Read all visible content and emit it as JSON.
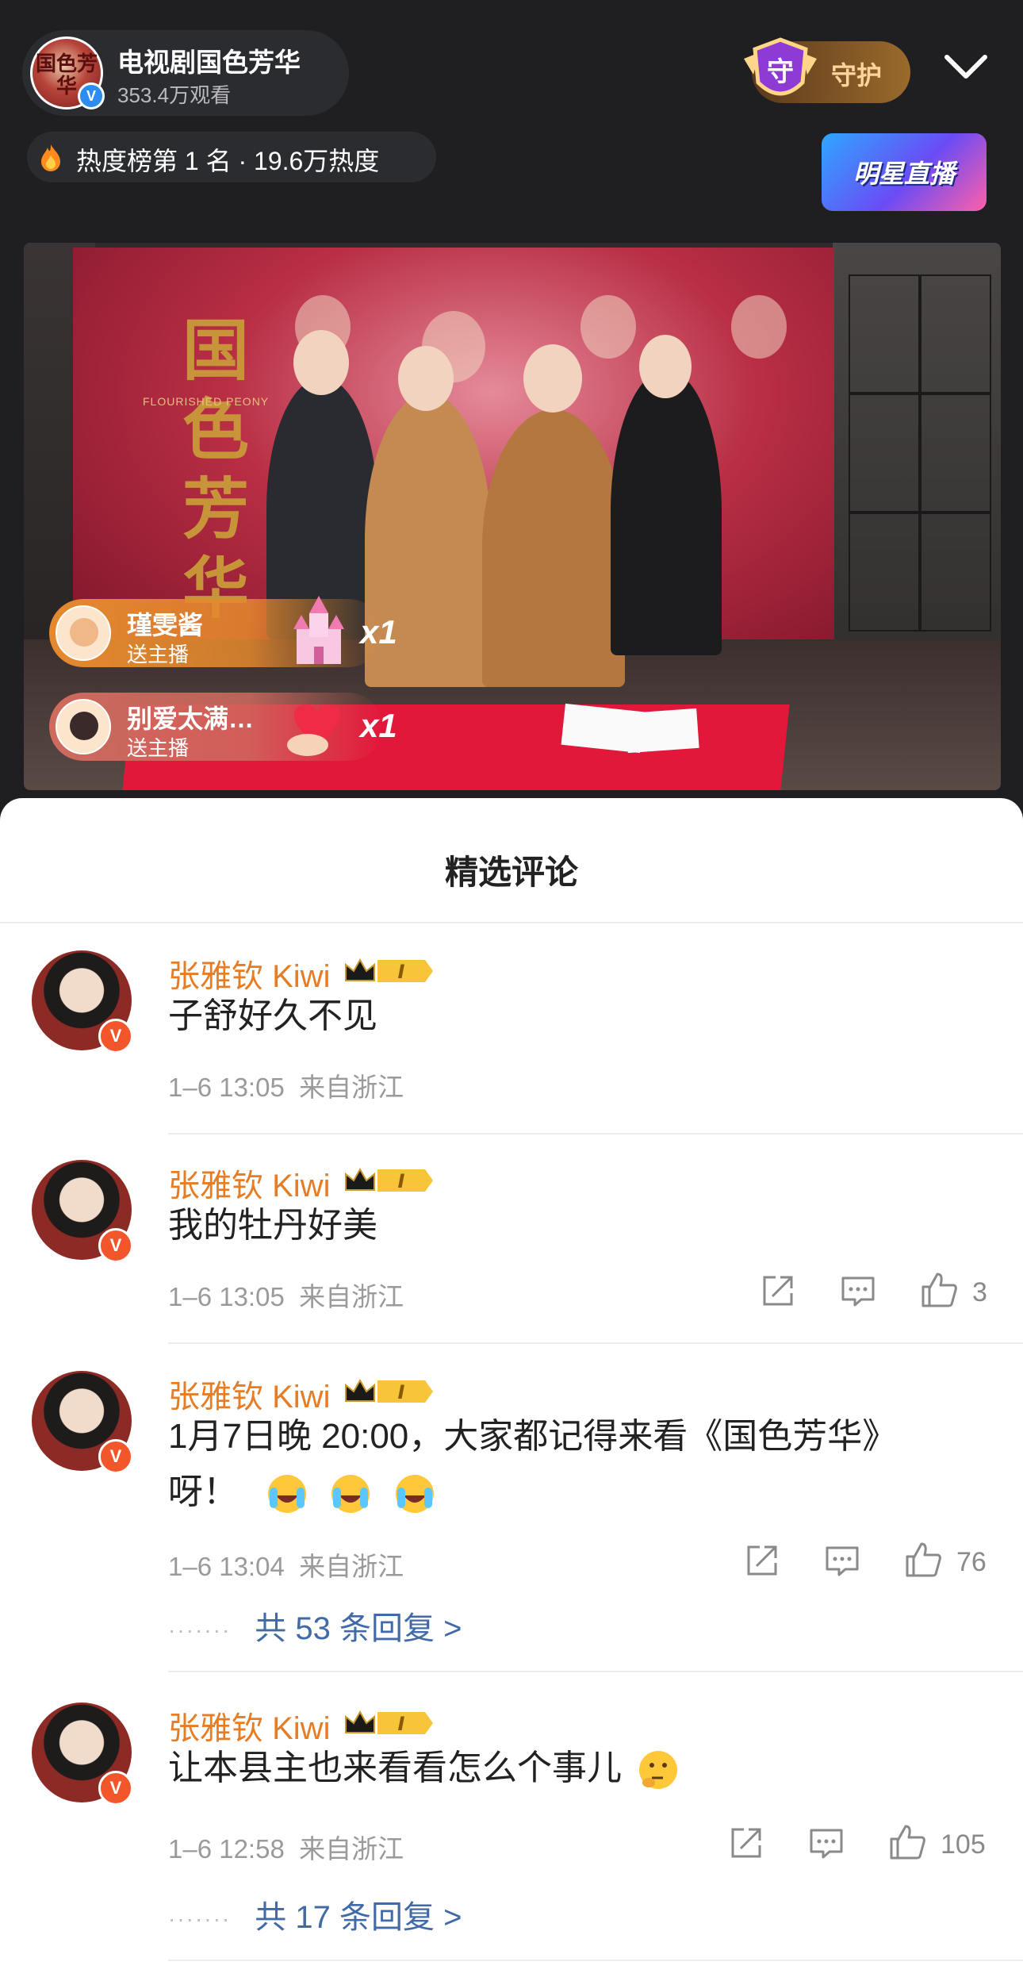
{
  "header": {
    "channel_name": "电视剧国色芳华",
    "views": "353.4万观看",
    "logo_text": "国色芳华",
    "guard_label": "守护",
    "guard_icon_char": "守",
    "heat_text": "热度榜第 1 名 · 19.6万热度",
    "star_live_label": "明星直播"
  },
  "video": {
    "poster_title": "国色芳华",
    "poster_subtitle": "FLOURISHED PEONY",
    "gifts": [
      {
        "name": "瑾雯酱",
        "action": "送主播",
        "item_icon": "castle-icon",
        "count": "x1"
      },
      {
        "name": "别爱太满…",
        "action": "送主播",
        "item_icon": "heart-hand-icon",
        "count": "x1"
      }
    ]
  },
  "comments_panel": {
    "title": "精选评论",
    "comments": [
      {
        "author": "张雅钦 Kiwi",
        "text": "子舒好久不见",
        "time": "1–6 13:05",
        "location": "来自浙江",
        "likes": "",
        "replies": ""
      },
      {
        "author": "张雅钦 Kiwi",
        "text": "我的牡丹好美",
        "time": "1–6 13:05",
        "location": "来自浙江",
        "likes": "3",
        "replies": ""
      },
      {
        "author": "张雅钦 Kiwi",
        "text_line1": "1月7日晚 20:00，大家都记得来看《国色芳华》",
        "text_line2": "呀！",
        "time": "1–6 13:04",
        "location": "来自浙江",
        "likes": "76",
        "replies": "共 53 条回复 >"
      },
      {
        "author": "张雅钦 Kiwi",
        "text": "让本县主也来看看怎么个事儿",
        "time": "1–6 12:58",
        "location": "来自浙江",
        "likes": "105",
        "replies": "共 17 条回复 >"
      }
    ]
  },
  "badges": {
    "verified": "V",
    "level": "I",
    "reply_dots": "·······"
  },
  "colors": {
    "accent_orange": "#e67c24",
    "link_blue": "#416aa7",
    "background_dark": "#1f1f22",
    "gift_orange": "#e5892e"
  }
}
